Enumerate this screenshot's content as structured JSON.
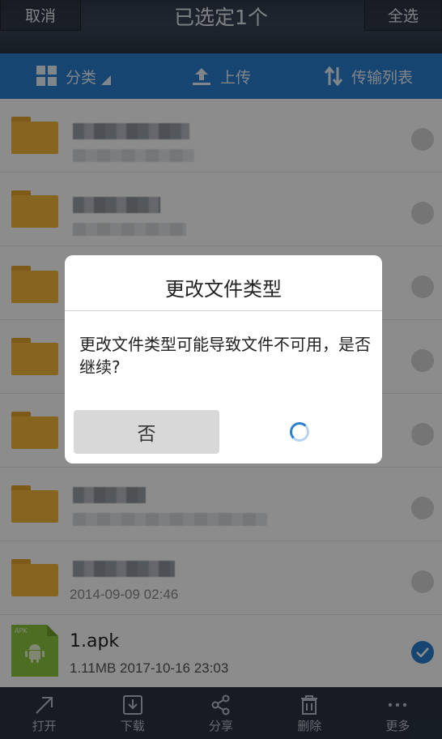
{
  "header": {
    "cancel_label": "取消",
    "title": "已选定1个",
    "select_all_label": "全选"
  },
  "toolbar": {
    "category_label": "分类",
    "upload_label": "上传",
    "transfer_label": "传输列表"
  },
  "files": [
    {
      "type": "folder",
      "checked": false
    },
    {
      "type": "folder",
      "checked": false
    },
    {
      "type": "folder",
      "checked": false
    },
    {
      "type": "folder",
      "checked": false
    },
    {
      "type": "folder",
      "checked": false
    },
    {
      "type": "folder",
      "checked": false
    },
    {
      "type": "folder",
      "checked": false,
      "meta": "2014-09-09  02:46"
    },
    {
      "type": "apk",
      "checked": true,
      "name": "1.apk",
      "meta": "1.11MB  2017-10-16  23:03",
      "icon_tag": "APK"
    }
  ],
  "dialog": {
    "title": "更改文件类型",
    "message": "更改文件类型可能导致文件不可用，是否继续?",
    "no_label": "否"
  },
  "bottom_bar": {
    "open_label": "打开",
    "download_label": "下载",
    "share_label": "分享",
    "delete_label": "删除",
    "more_label": "更多"
  },
  "colors": {
    "accent": "#2b7fce",
    "folder": "#f3b93a",
    "apk": "#8cc63f"
  }
}
